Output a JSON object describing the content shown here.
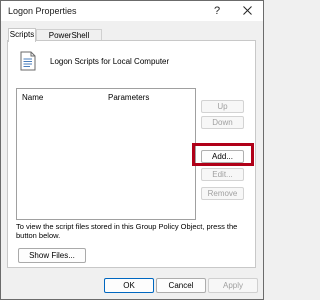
{
  "window": {
    "title": "Logon Properties",
    "help_glyph": "?"
  },
  "tabs": [
    {
      "label": "Scripts"
    },
    {
      "label": "PowerShell Scripts"
    }
  ],
  "header": {
    "text": "Logon Scripts for Local Computer",
    "icon": "document-icon"
  },
  "list": {
    "columns": [
      "Name",
      "Parameters"
    ]
  },
  "buttons": {
    "up": "Up",
    "down": "Down",
    "add": "Add...",
    "edit": "Edit...",
    "remove": "Remove",
    "show_files": "Show Files..."
  },
  "info_text": "To view the script files stored in this Group Policy Object, press the button below.",
  "footer": {
    "ok": "OK",
    "cancel": "Cancel",
    "apply": "Apply"
  },
  "colors": {
    "highlight": "#b00018",
    "ok_border": "#0067c0"
  }
}
